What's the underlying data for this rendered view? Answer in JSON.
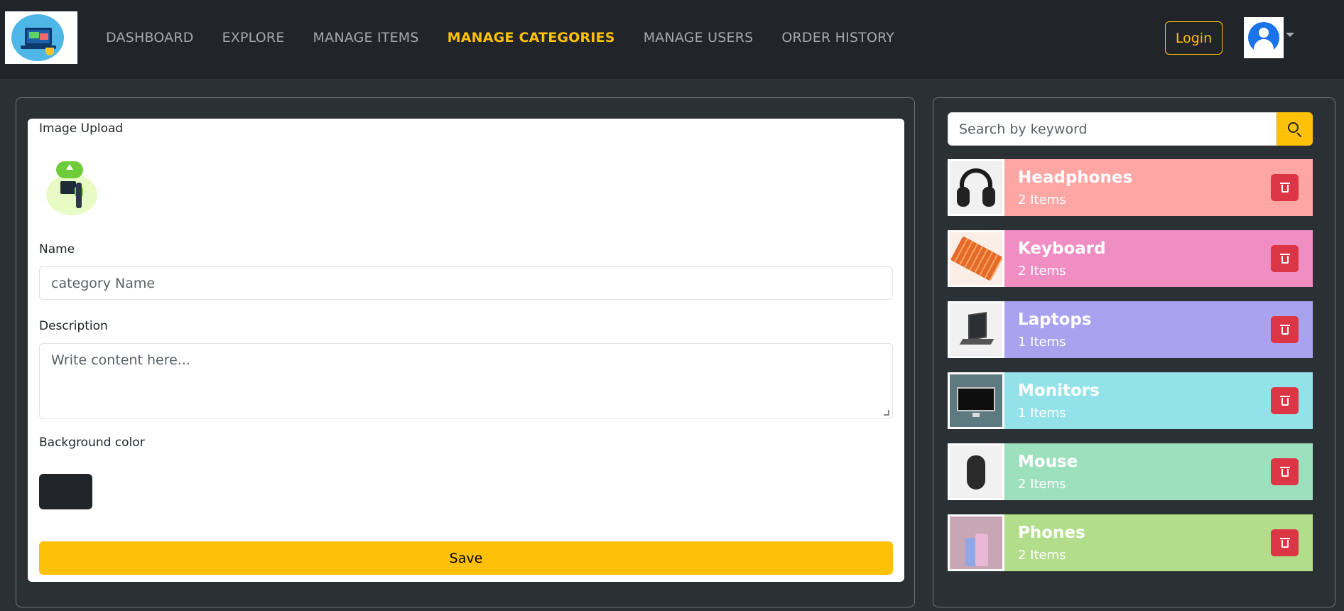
{
  "nav": {
    "items": [
      {
        "label": "DASHBOARD",
        "active": false
      },
      {
        "label": "EXPLORE",
        "active": false
      },
      {
        "label": "MANAGE ITEMS",
        "active": false
      },
      {
        "label": "MANAGE CATEGORIES",
        "active": true
      },
      {
        "label": "MANAGE USERS",
        "active": false
      },
      {
        "label": "ORDER HISTORY",
        "active": false
      }
    ],
    "login_label": "Login",
    "logo_icon": "laptop-shop-logo",
    "avatar_icon": "user-avatar-icon",
    "dropdown_icon": "caret-down-icon"
  },
  "form": {
    "image_upload_label": "Image Upload",
    "upload_icon": "cloud-upload-illustration",
    "name_label": "Name",
    "name_placeholder": "category Name",
    "description_label": "Description",
    "description_placeholder": "Write content here...",
    "background_color_label": "Background color",
    "background_color_value": "#212529",
    "save_label": "Save"
  },
  "search": {
    "placeholder": "Search by keyword",
    "icon": "search-icon"
  },
  "categories": [
    {
      "name": "Headphones",
      "count": "2 Items",
      "color": "#fea6a4",
      "thumb": "headphones"
    },
    {
      "name": "Keyboard",
      "count": "2 Items",
      "color": "#f08ec4",
      "thumb": "keyboard"
    },
    {
      "name": "Laptops",
      "count": "1 Items",
      "color": "#a9a2ef",
      "thumb": "laptop"
    },
    {
      "name": "Monitors",
      "count": "1 Items",
      "color": "#94e2e9",
      "thumb": "monitor"
    },
    {
      "name": "Mouse",
      "count": "2 Items",
      "color": "#9de0bd",
      "thumb": "mouse"
    },
    {
      "name": "Phones",
      "count": "2 Items",
      "color": "#b2dd8a",
      "thumb": "phones"
    }
  ],
  "colors": {
    "accent": "#ffc107",
    "navbar_bg": "#212529",
    "page_bg": "#2b3035",
    "danger": "#dc3545"
  }
}
